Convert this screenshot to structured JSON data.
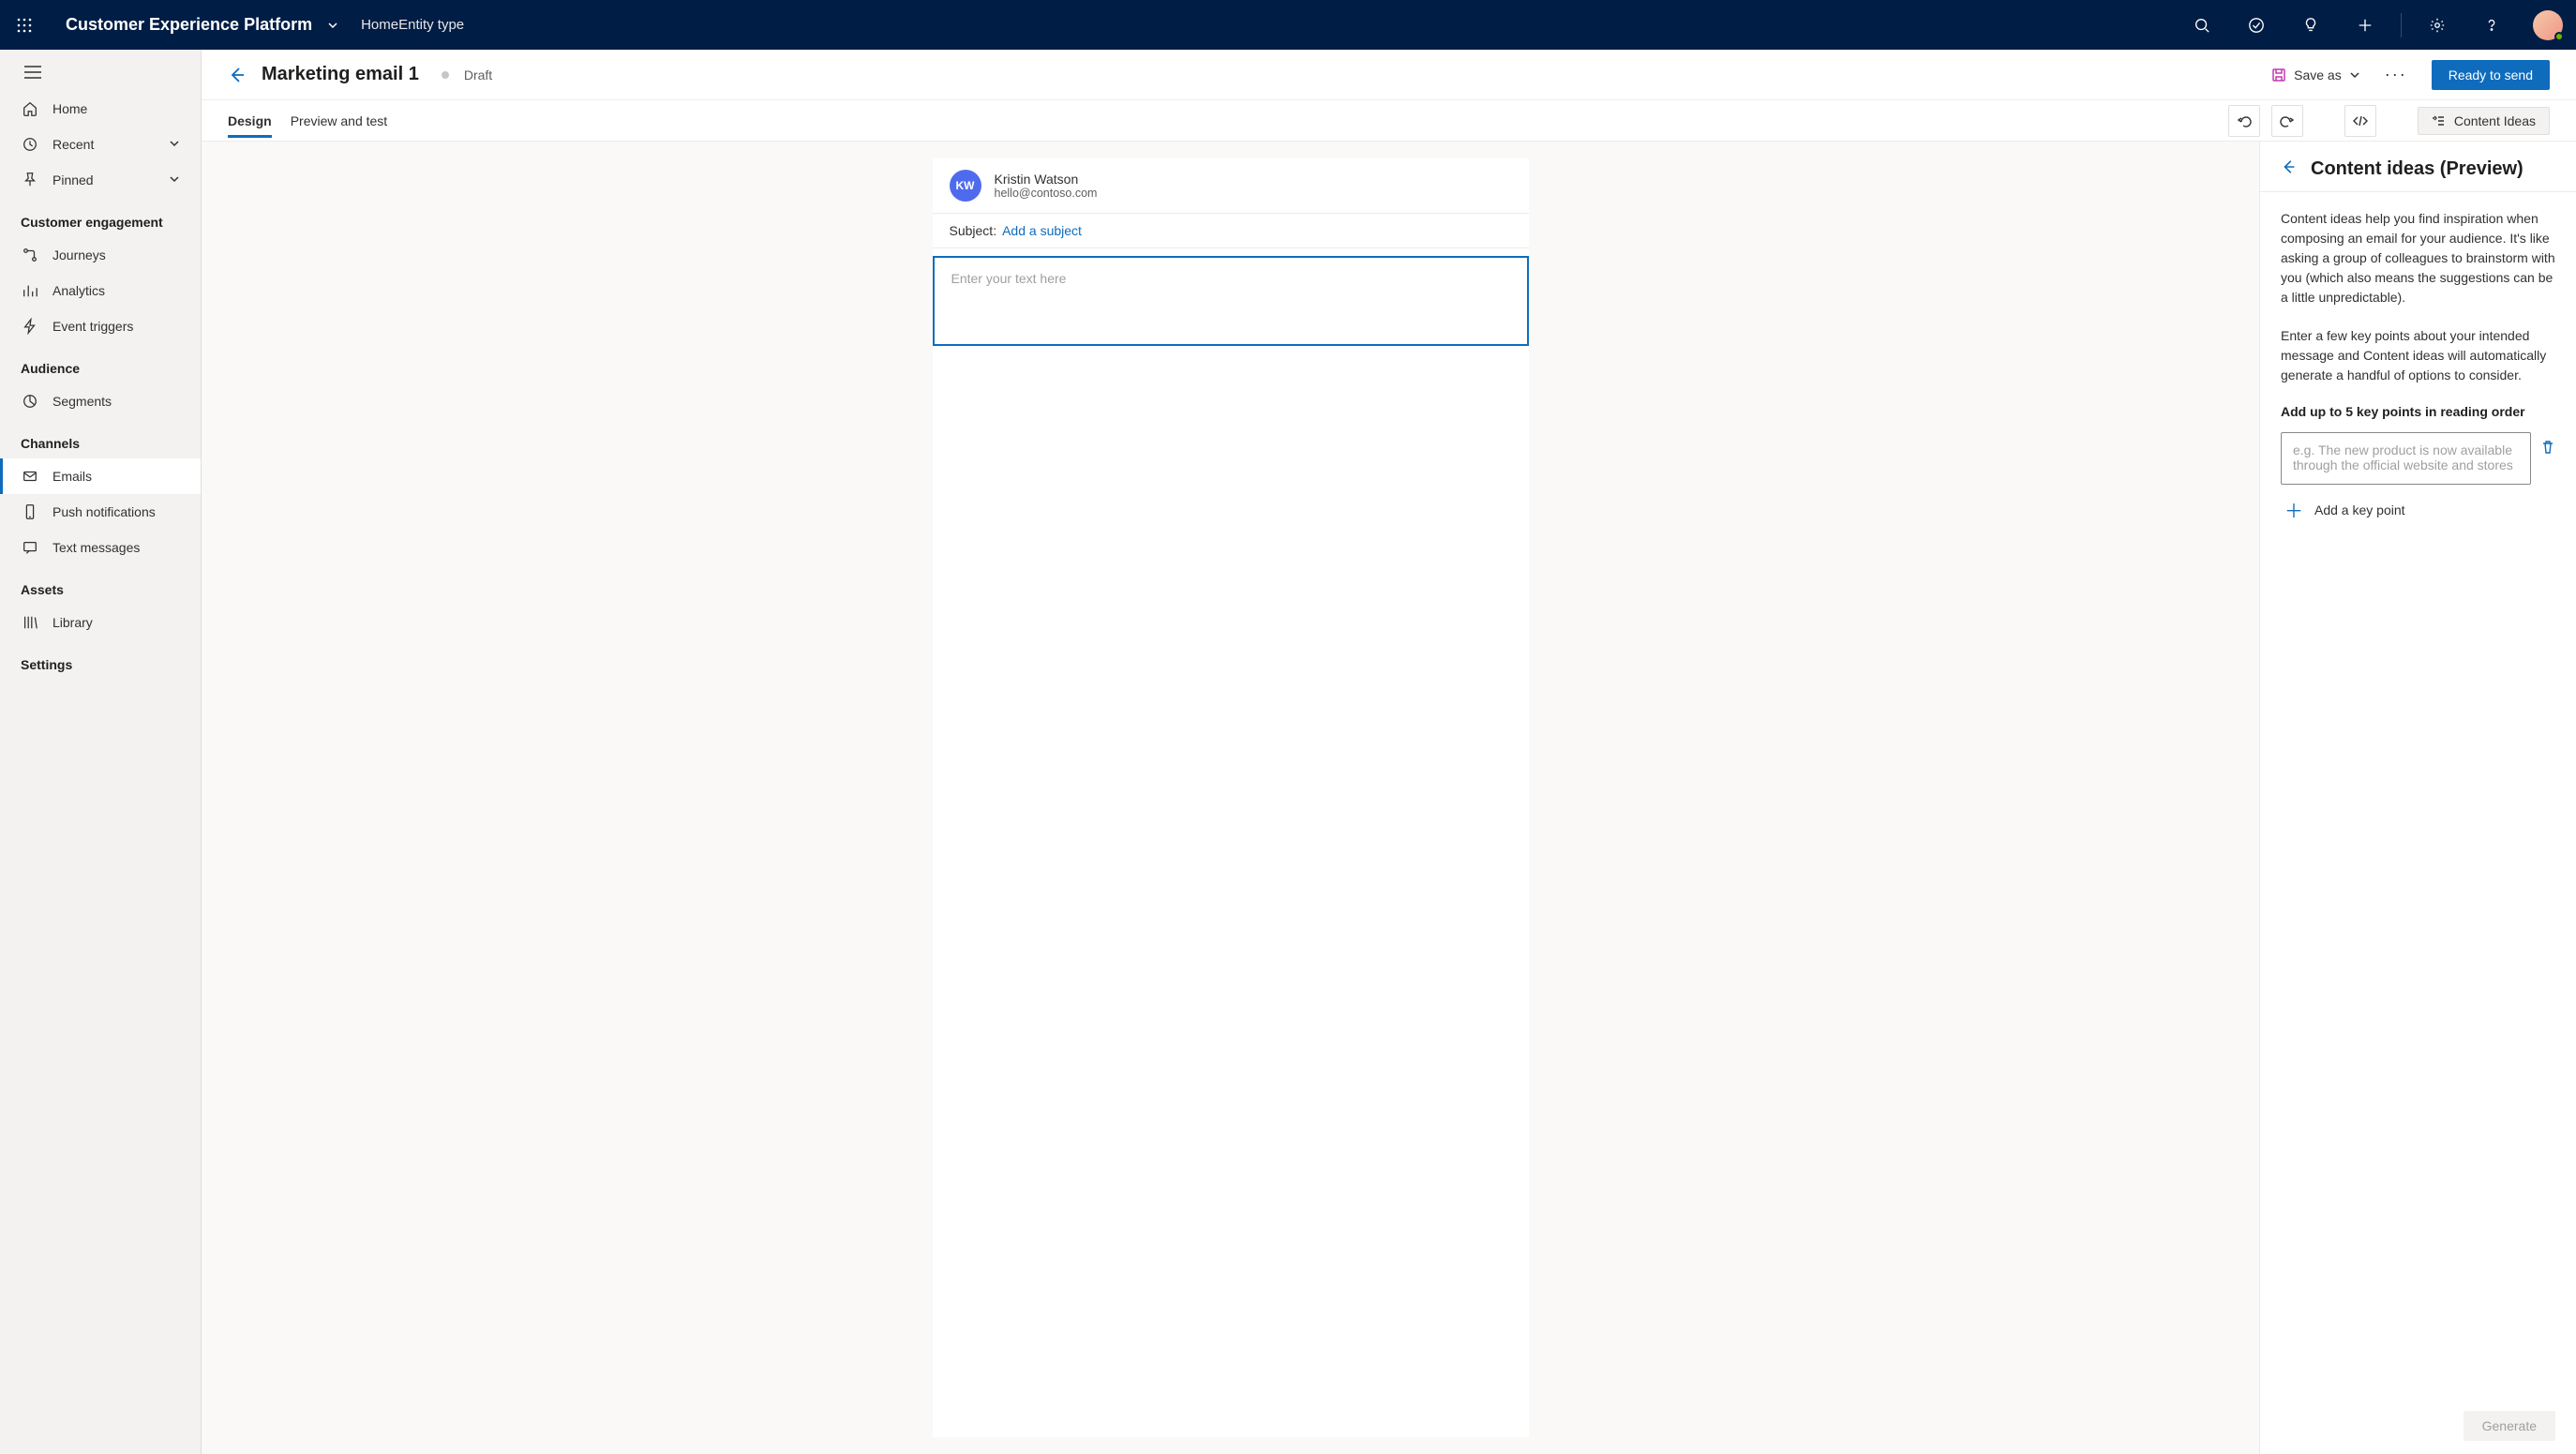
{
  "header": {
    "app_title": "Customer Experience Platform",
    "breadcrumb": [
      "Home",
      "Entity type"
    ]
  },
  "sidebar": {
    "top": [
      {
        "icon": "home",
        "label": "Home"
      },
      {
        "icon": "clock",
        "label": "Recent",
        "expandable": true
      },
      {
        "icon": "pin",
        "label": "Pinned",
        "expandable": true
      }
    ],
    "groups": [
      {
        "title": "Customer engagement",
        "items": [
          {
            "icon": "route",
            "label": "Journeys"
          },
          {
            "icon": "analytics",
            "label": "Analytics"
          },
          {
            "icon": "bolt",
            "label": "Event triggers"
          }
        ]
      },
      {
        "title": "Audience",
        "items": [
          {
            "icon": "segment",
            "label": "Segments"
          }
        ]
      },
      {
        "title": "Channels",
        "items": [
          {
            "icon": "mail",
            "label": "Emails",
            "selected": true
          },
          {
            "icon": "phone",
            "label": "Push notifications"
          },
          {
            "icon": "sms",
            "label": "Text messages"
          }
        ]
      },
      {
        "title": "Assets",
        "items": [
          {
            "icon": "library",
            "label": "Library"
          }
        ]
      },
      {
        "title": "Settings",
        "items": []
      }
    ]
  },
  "page": {
    "title": "Marketing email 1",
    "status": "Draft",
    "save_label": "Save as",
    "primary_action": "Ready to send",
    "tabs": [
      "Design",
      "Preview and test"
    ],
    "content_ideas_btn": "Content Ideas"
  },
  "email": {
    "from_initials": "KW",
    "from_name": "Kristin Watson",
    "from_email": "hello@contoso.com",
    "subject_label": "Subject:",
    "subject_link": "Add a subject",
    "body_placeholder": "Enter your text here"
  },
  "content_ideas": {
    "title": "Content ideas (Preview)",
    "para1": "Content ideas help you find inspiration when composing an email for your audience. It's like asking a group of colleagues to brainstorm with you (which also means the suggestions can be a little unpredictable).",
    "para2": "Enter a few key points about your intended message and Content ideas will automatically generate a handful of options to consider.",
    "keypoints_label": "Add up to 5 key points in reading order",
    "keypoint_placeholder": "e.g. The new product is now available through the official website and stores",
    "add_keypoint": "Add a key point",
    "generate": "Generate"
  }
}
